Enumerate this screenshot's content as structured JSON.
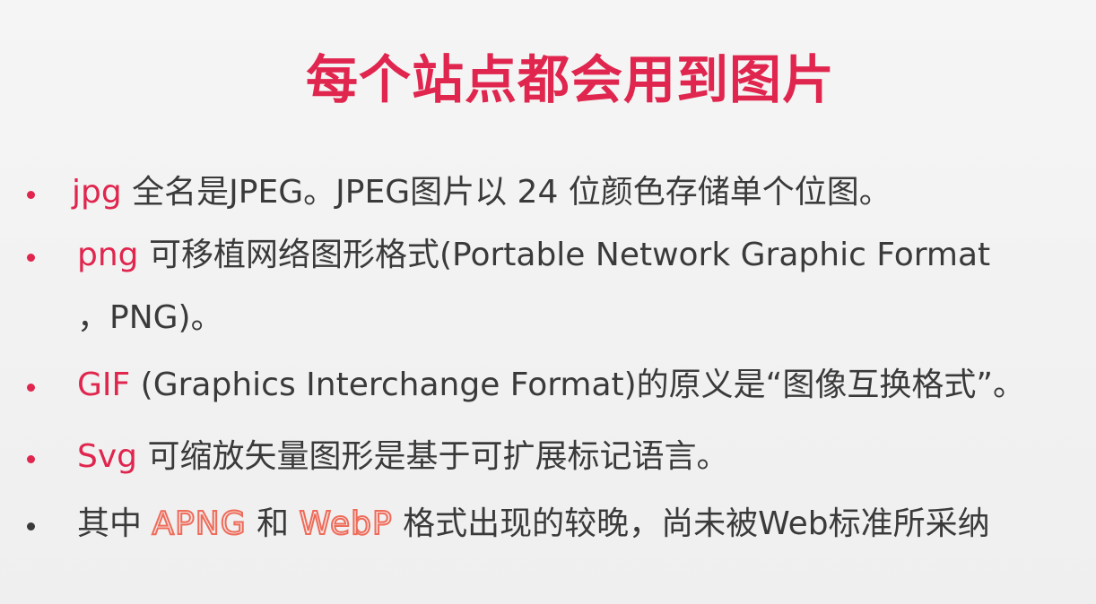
{
  "slide": {
    "title": "每个站点都会用到图片",
    "bullets": [
      {
        "keyword": "jpg",
        "text": " 全名是JPEG。JPEG图片以 24 位颜色存储单个位图。"
      },
      {
        "keyword": "png",
        "text": " 可移植网络图形格式(Portable Network Graphic Format",
        "continuation": "，PNG)。"
      },
      {
        "keyword": "GIF",
        "text": " (Graphics Interchange Format)的原义是“图像互换格式”。"
      },
      {
        "keyword": "Svg",
        "text": " 可缩放矢量图形是基于可扩展标记语言。"
      },
      {
        "prefix": "其中 ",
        "highlight1": "APNG",
        "middle": " 和 ",
        "highlight2": "WebP",
        "suffix": " 格式出现的较晚，尚未被Web标准所采纳"
      }
    ]
  },
  "colors": {
    "accent": "#e0264e",
    "text": "#3a3a3a",
    "background": "#f3f3f3"
  }
}
